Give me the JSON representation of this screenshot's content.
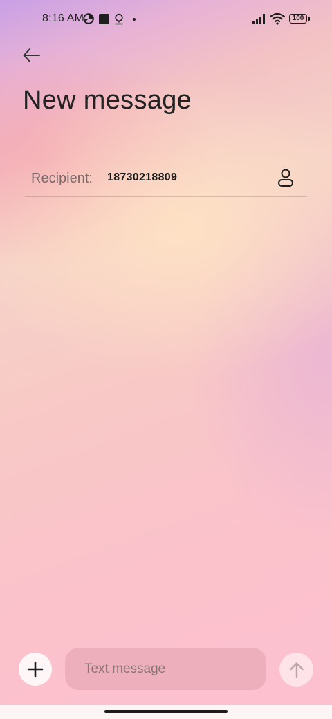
{
  "status_bar": {
    "time": "8:16 AM",
    "battery_level": "100",
    "icons": [
      "netspeed-icon",
      "app-square-icon",
      "location-pin-icon",
      "dot-icon",
      "signal-icon",
      "wifi-icon",
      "battery-icon"
    ]
  },
  "header": {
    "back_icon": "arrow-left-icon",
    "title": "New message"
  },
  "recipient": {
    "label": "Recipient:",
    "value": "18730218809",
    "contact_icon": "person-icon"
  },
  "compose": {
    "attach_icon": "plus-icon",
    "placeholder": "Text message",
    "send_icon": "arrow-up-icon"
  },
  "colors": {
    "text_primary": "#222222",
    "label_muted": "#7a6b6b",
    "input_bg": "#e1a0af",
    "gradient_top": "#c9a0e6",
    "gradient_bottom": "#fcc0cf"
  }
}
